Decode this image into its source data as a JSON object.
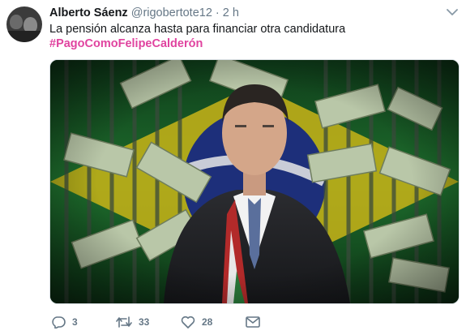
{
  "tweet": {
    "author_name": "Alberto Sáenz",
    "handle": "@rigobertote12",
    "separator": "·",
    "time": "2 h",
    "text": "La pensión alcanza hasta para financiar otra candidatura",
    "hashtag": "#PagoComoFelipeCalderón"
  },
  "actions": {
    "reply_count": "3",
    "retweet_count": "33",
    "like_count": "28"
  },
  "colors": {
    "hashtag": "#e0439f",
    "meta_gray": "#657786"
  },
  "icons": [
    "chevron-down-icon",
    "reply-icon",
    "retweet-icon",
    "heart-icon",
    "message-icon"
  ]
}
